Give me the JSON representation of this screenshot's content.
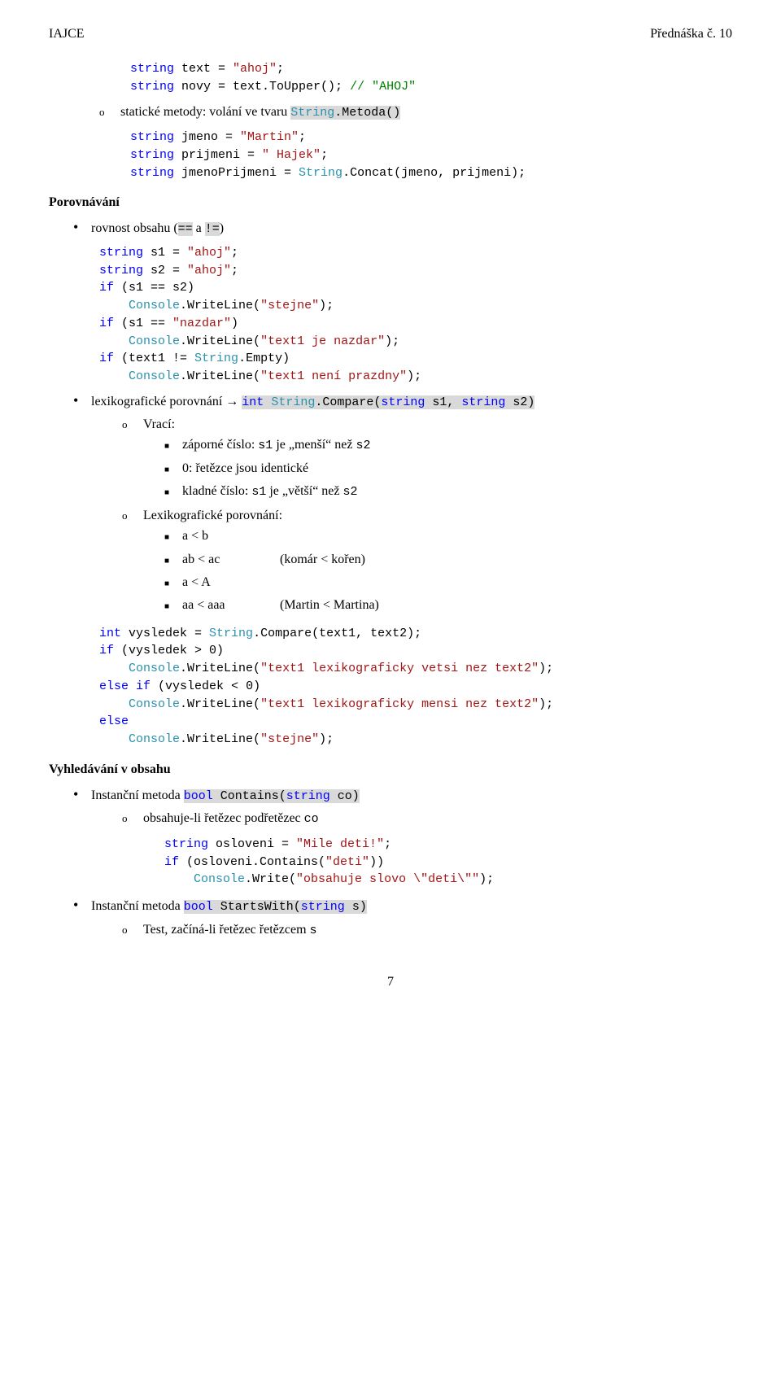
{
  "header": {
    "left": "IAJCE",
    "right": "Přednáška č. 10"
  },
  "code1": {
    "l1a": "string",
    "l1b": " text = ",
    "l1c": "\"ahoj\"",
    "l1d": ";",
    "l2a": "string",
    "l2b": " novy = text.ToUpper(); ",
    "l2c": "// \"AHOJ\""
  },
  "sub1": {
    "circ": "o",
    "text1": "statické metody: volání ve tvaru ",
    "code1": "String",
    "code2": ".Metoda()"
  },
  "code2": {
    "l1a": "string",
    "l1b": " jmeno = ",
    "l1c": "\"Martin\"",
    "l1d": ";",
    "l2a": "string",
    "l2b": " prijmeni = ",
    "l2c": "\" Hajek\"",
    "l2d": ";",
    "l3a": "string",
    "l3b": " jmenoPrijmeni = ",
    "l3c": "String",
    "l3d": ".Concat(jmeno, prijmeni);"
  },
  "sec1": {
    "title": "Porovnávání",
    "b1a": "rovnost obsahu (",
    "b1b": "==",
    "b1c": "  a ",
    "b1d": "!=",
    "b1e": ")"
  },
  "code3": {
    "l1a": "string",
    "l1b": " s1 = ",
    "l1c": "\"ahoj\"",
    "l1d": ";",
    "l2a": "string",
    "l2b": " s2 = ",
    "l2c": "\"ahoj\"",
    "l2d": ";",
    "l3a": "if",
    "l3b": " (s1 == s2)",
    "l4a": "    ",
    "l4b": "Console",
    "l4c": ".WriteLine(",
    "l4d": "\"stejne\"",
    "l4e": ");",
    "l5a": "if",
    "l5b": " (s1 == ",
    "l5c": "\"nazdar\"",
    "l5d": ")",
    "l6a": "    ",
    "l6b": "Console",
    "l6c": ".WriteLine(",
    "l6d": "\"text1 je nazdar\"",
    "l6e": ");",
    "l7a": "if",
    "l7b": " (text1 != ",
    "l7c": "String",
    "l7d": ".Empty)",
    "l8a": "    ",
    "l8b": "Console",
    "l8c": ".WriteLine(",
    "l8d": "\"text1 není prazdny\"",
    "l8e": ");"
  },
  "lex": {
    "label": "lexikografické porovnání → ",
    "c1": "int",
    "c2": " ",
    "c3": "String",
    "c4": ".Compare(",
    "c5": "string",
    "c6": " s1, ",
    "c7": "string",
    "c8": " s2)",
    "vraci": "Vrací:",
    "i1a": "záporné číslo: ",
    "i1b": "s1",
    "i1c": " je „menší“ než ",
    "i1d": "s2",
    "i2": "0: řetězce jsou identické",
    "i3a": "kladné číslo: ",
    "i3b": "s1",
    "i3c": " je „větší“ než ",
    "i3d": "s2",
    "lp": "Lexikografické porovnání:",
    "r1": "a < b",
    "r2a": "ab < ac",
    "r2b": "(komár < kořen)",
    "r3": "a < A",
    "r4a": "aa < aaa",
    "r4b": "(Martin < Martina)"
  },
  "code4": {
    "l1a": "int",
    "l1b": " vysledek = ",
    "l1c": "String",
    "l1d": ".Compare(text1, text2);",
    "l2a": "if",
    "l2b": " (vysledek > 0)",
    "l3a": "    ",
    "l3b": "Console",
    "l3c": ".WriteLine(",
    "l3d": "\"text1 lexikograficky vetsi nez text2\"",
    "l3e": ");",
    "l4a": "else",
    "l4b": " ",
    "l4c": "if",
    "l4d": " (vysledek < 0)",
    "l5a": "    ",
    "l5b": "Console",
    "l5c": ".WriteLine(",
    "l5d": "\"text1 lexikograficky mensi nez text2\"",
    "l5e": ");",
    "l6a": "else",
    "l7a": "    ",
    "l7b": "Console",
    "l7c": ".WriteLine(",
    "l7d": "\"stejne\"",
    "l7e": ");"
  },
  "sec2": {
    "title": "Vyhledávání v obsahu",
    "b1a": "Instanční metoda ",
    "b1b": "bool",
    "b1c": " Contains(",
    "b1d": "string",
    "b1e": " co)",
    "o1a": "obsahuje-li řetězec podřetězec ",
    "o1b": "co"
  },
  "code5": {
    "l1a": "string",
    "l1b": " osloveni = ",
    "l1c": "\"Mile deti!\"",
    "l1d": ";",
    "l2a": "if",
    "l2b": " (osloveni.Contains(",
    "l2c": "\"deti\"",
    "l2d": "))",
    "l3a": "    ",
    "l3b": "Console",
    "l3c": ".Write(",
    "l3d": "\"obsahuje slovo \\\"deti\\\"\"",
    "l3e": ");"
  },
  "sec3": {
    "b1a": "Instanční metoda ",
    "b1b": "bool",
    "b1c": " StartsWith(",
    "b1d": "string",
    "b1e": " s)",
    "o1a": "Test, začíná-li řetězec řetězcem ",
    "o1b": "s"
  },
  "pagenum": "7"
}
